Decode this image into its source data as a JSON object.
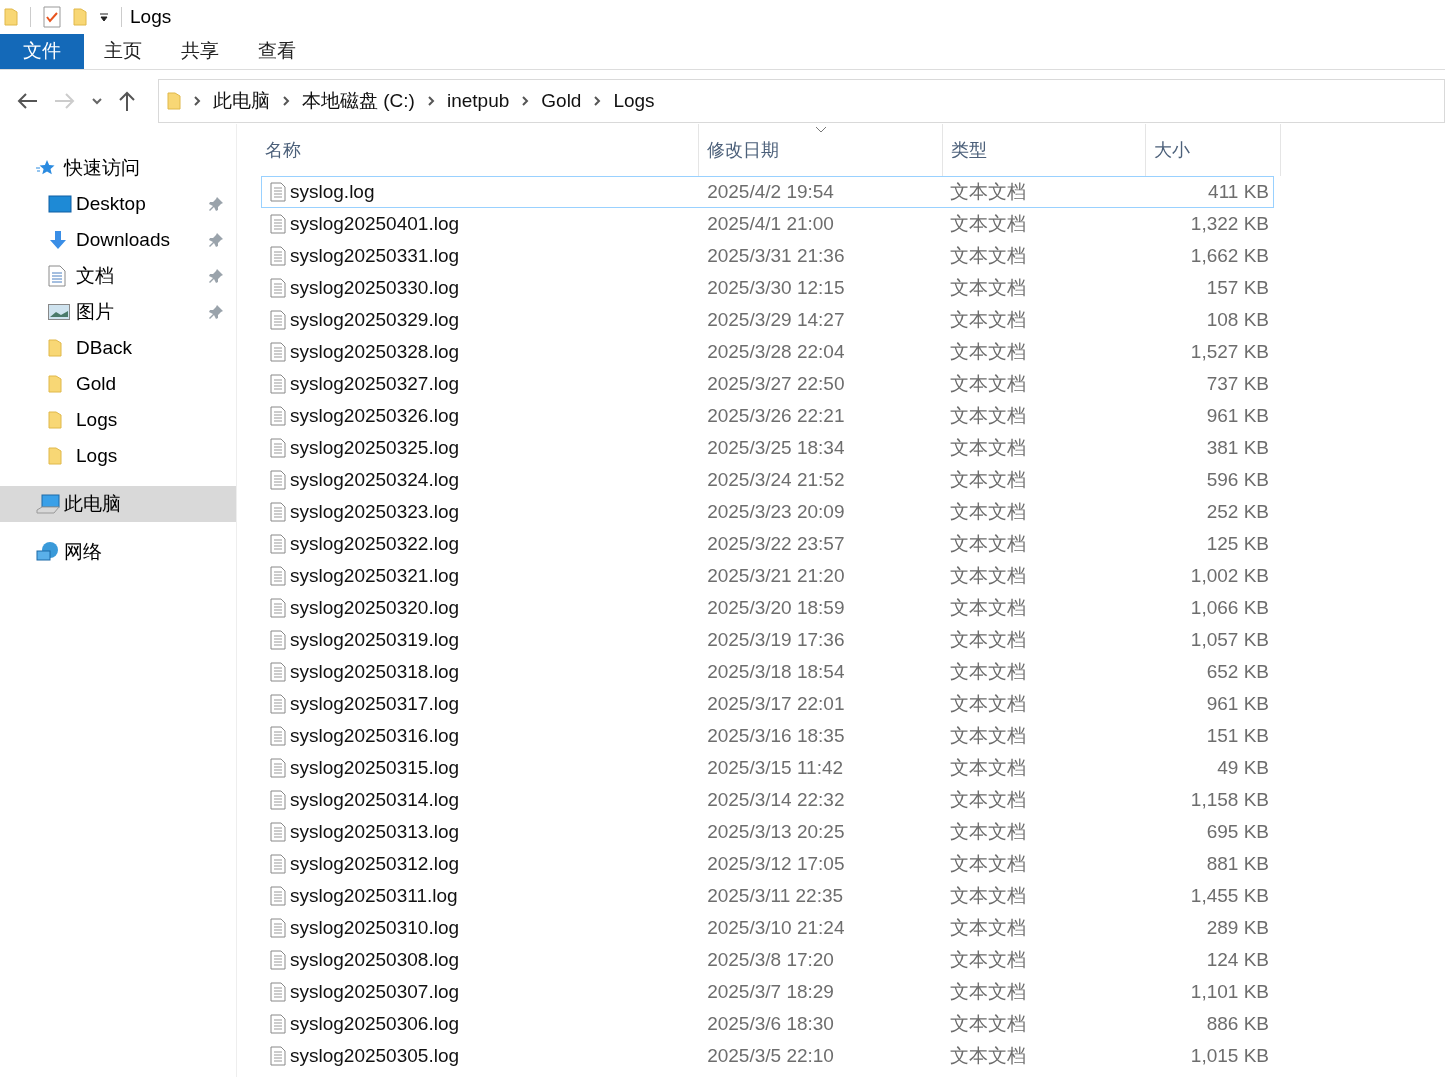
{
  "window": {
    "title": "Logs"
  },
  "ribbon_tabs": [
    {
      "label": "文件",
      "kind": "file"
    },
    {
      "label": "主页",
      "kind": "tab"
    },
    {
      "label": "共享",
      "kind": "tab"
    },
    {
      "label": "查看",
      "kind": "tab"
    }
  ],
  "breadcrumbs": [
    "此电脑",
    "本地磁盘 (C:)",
    "inetpub",
    "Gold",
    "Logs"
  ],
  "sidebar": {
    "items": [
      {
        "label": "快速访问",
        "kind": "star",
        "selected": false,
        "children": [
          {
            "label": "Desktop",
            "kind": "desktop",
            "pinned": true,
            "selected": false
          },
          {
            "label": "Downloads",
            "kind": "download",
            "pinned": true,
            "selected": false
          },
          {
            "label": "文档",
            "kind": "document",
            "pinned": true,
            "selected": false
          },
          {
            "label": "图片",
            "kind": "picture",
            "pinned": true,
            "selected": false
          },
          {
            "label": "DBack",
            "kind": "folder",
            "pinned": false,
            "selected": false
          },
          {
            "label": "Gold",
            "kind": "folder",
            "pinned": false,
            "selected": false
          },
          {
            "label": "Logs",
            "kind": "folder",
            "pinned": false,
            "selected": false
          },
          {
            "label": "Logs",
            "kind": "folder",
            "pinned": false,
            "selected": false
          }
        ]
      },
      {
        "label": "此电脑",
        "kind": "computer",
        "selected": true
      },
      {
        "label": "网络",
        "kind": "network",
        "selected": false
      }
    ]
  },
  "table": {
    "columns": [
      {
        "label": "名称",
        "sorted": false
      },
      {
        "label": "修改日期",
        "sorted": true
      },
      {
        "label": "类型",
        "sorted": false
      },
      {
        "label": "大小",
        "sorted": false
      }
    ],
    "rows": [
      {
        "name": "syslog.log",
        "modified": "2025/4/2 19:54",
        "type": "文本文档",
        "size": "411 KB",
        "focused": true
      },
      {
        "name": "syslog20250401.log",
        "modified": "2025/4/1 21:00",
        "type": "文本文档",
        "size": "1,322 KB",
        "focused": false
      },
      {
        "name": "syslog20250331.log",
        "modified": "2025/3/31 21:36",
        "type": "文本文档",
        "size": "1,662 KB",
        "focused": false
      },
      {
        "name": "syslog20250330.log",
        "modified": "2025/3/30 12:15",
        "type": "文本文档",
        "size": "157 KB",
        "focused": false
      },
      {
        "name": "syslog20250329.log",
        "modified": "2025/3/29 14:27",
        "type": "文本文档",
        "size": "108 KB",
        "focused": false
      },
      {
        "name": "syslog20250328.log",
        "modified": "2025/3/28 22:04",
        "type": "文本文档",
        "size": "1,527 KB",
        "focused": false
      },
      {
        "name": "syslog20250327.log",
        "modified": "2025/3/27 22:50",
        "type": "文本文档",
        "size": "737 KB",
        "focused": false
      },
      {
        "name": "syslog20250326.log",
        "modified": "2025/3/26 22:21",
        "type": "文本文档",
        "size": "961 KB",
        "focused": false
      },
      {
        "name": "syslog20250325.log",
        "modified": "2025/3/25 18:34",
        "type": "文本文档",
        "size": "381 KB",
        "focused": false
      },
      {
        "name": "syslog20250324.log",
        "modified": "2025/3/24 21:52",
        "type": "文本文档",
        "size": "596 KB",
        "focused": false
      },
      {
        "name": "syslog20250323.log",
        "modified": "2025/3/23 20:09",
        "type": "文本文档",
        "size": "252 KB",
        "focused": false
      },
      {
        "name": "syslog20250322.log",
        "modified": "2025/3/22 23:57",
        "type": "文本文档",
        "size": "125 KB",
        "focused": false
      },
      {
        "name": "syslog20250321.log",
        "modified": "2025/3/21 21:20",
        "type": "文本文档",
        "size": "1,002 KB",
        "focused": false
      },
      {
        "name": "syslog20250320.log",
        "modified": "2025/3/20 18:59",
        "type": "文本文档",
        "size": "1,066 KB",
        "focused": false
      },
      {
        "name": "syslog20250319.log",
        "modified": "2025/3/19 17:36",
        "type": "文本文档",
        "size": "1,057 KB",
        "focused": false
      },
      {
        "name": "syslog20250318.log",
        "modified": "2025/3/18 18:54",
        "type": "文本文档",
        "size": "652 KB",
        "focused": false
      },
      {
        "name": "syslog20250317.log",
        "modified": "2025/3/17 22:01",
        "type": "文本文档",
        "size": "961 KB",
        "focused": false
      },
      {
        "name": "syslog20250316.log",
        "modified": "2025/3/16 18:35",
        "type": "文本文档",
        "size": "151 KB",
        "focused": false
      },
      {
        "name": "syslog20250315.log",
        "modified": "2025/3/15 11:42",
        "type": "文本文档",
        "size": "49 KB",
        "focused": false
      },
      {
        "name": "syslog20250314.log",
        "modified": "2025/3/14 22:32",
        "type": "文本文档",
        "size": "1,158 KB",
        "focused": false
      },
      {
        "name": "syslog20250313.log",
        "modified": "2025/3/13 20:25",
        "type": "文本文档",
        "size": "695 KB",
        "focused": false
      },
      {
        "name": "syslog20250312.log",
        "modified": "2025/3/12 17:05",
        "type": "文本文档",
        "size": "881 KB",
        "focused": false
      },
      {
        "name": "syslog20250311.log",
        "modified": "2025/3/11 22:35",
        "type": "文本文档",
        "size": "1,455 KB",
        "focused": false
      },
      {
        "name": "syslog20250310.log",
        "modified": "2025/3/10 21:24",
        "type": "文本文档",
        "size": "289 KB",
        "focused": false
      },
      {
        "name": "syslog20250308.log",
        "modified": "2025/3/8 17:20",
        "type": "文本文档",
        "size": "124 KB",
        "focused": false
      },
      {
        "name": "syslog20250307.log",
        "modified": "2025/3/7 18:29",
        "type": "文本文档",
        "size": "1,101 KB",
        "focused": false
      },
      {
        "name": "syslog20250306.log",
        "modified": "2025/3/6 18:30",
        "type": "文本文档",
        "size": "886 KB",
        "focused": false
      },
      {
        "name": "syslog20250305.log",
        "modified": "2025/3/5 22:10",
        "type": "文本文档",
        "size": "1,015 KB",
        "focused": false
      }
    ]
  }
}
